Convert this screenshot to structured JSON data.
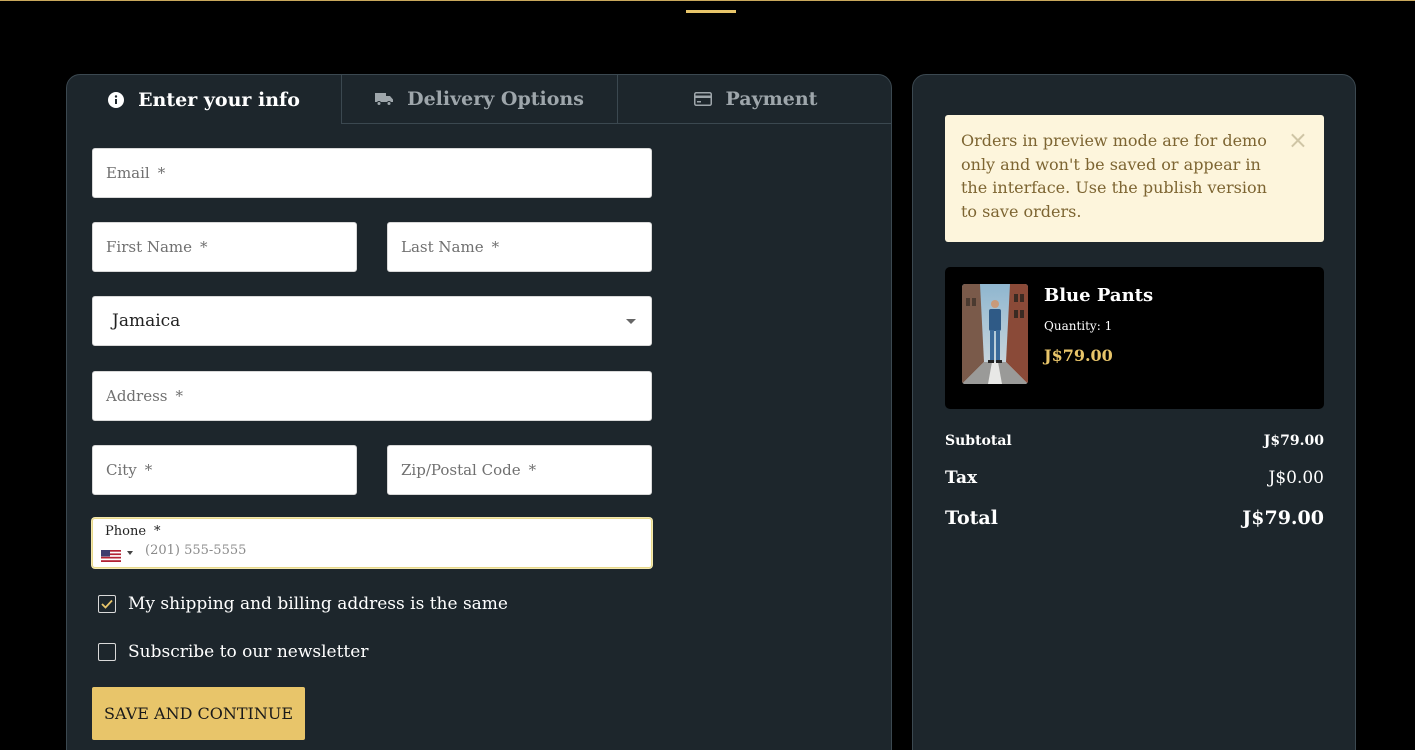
{
  "tabs": [
    {
      "label": "Enter your info",
      "icon": "info-icon"
    },
    {
      "label": "Delivery Options",
      "icon": "truck-icon"
    },
    {
      "label": "Payment",
      "icon": "credit-card-icon"
    }
  ],
  "form": {
    "email_placeholder": "Email",
    "first_name_placeholder": "First Name",
    "last_name_placeholder": "Last Name",
    "country_value": "Jamaica",
    "address_placeholder": "Address",
    "city_placeholder": "City",
    "zip_placeholder": "Zip/Postal Code",
    "phone_label": "Phone",
    "phone_placeholder": "(201) 555-5555",
    "required_mark": "*",
    "same_address_label": "My shipping and billing address is the same",
    "same_address_checked": true,
    "newsletter_label": "Subscribe to our newsletter",
    "newsletter_checked": false,
    "save_button": "SAVE AND CONTINUE"
  },
  "notice": {
    "text": "Orders in preview mode are for demo only and won't be saved or appear in the interface. Use the publish version to save orders.",
    "close": "×"
  },
  "cart": {
    "item_name": "Blue Pants",
    "quantity": "Quantity: 1",
    "price": "J$79.00"
  },
  "summary": {
    "subtotal_label": "Subtotal",
    "subtotal_value": "J$79.00",
    "tax_label": "Tax",
    "tax_value": "J$0.00",
    "total_label": "Total",
    "total_value": "J$79.00"
  },
  "colors": {
    "accent": "#e8c56a",
    "card_bg": "#1d262c",
    "notice_bg": "#fdf5dc",
    "notice_text": "#7d6532"
  }
}
